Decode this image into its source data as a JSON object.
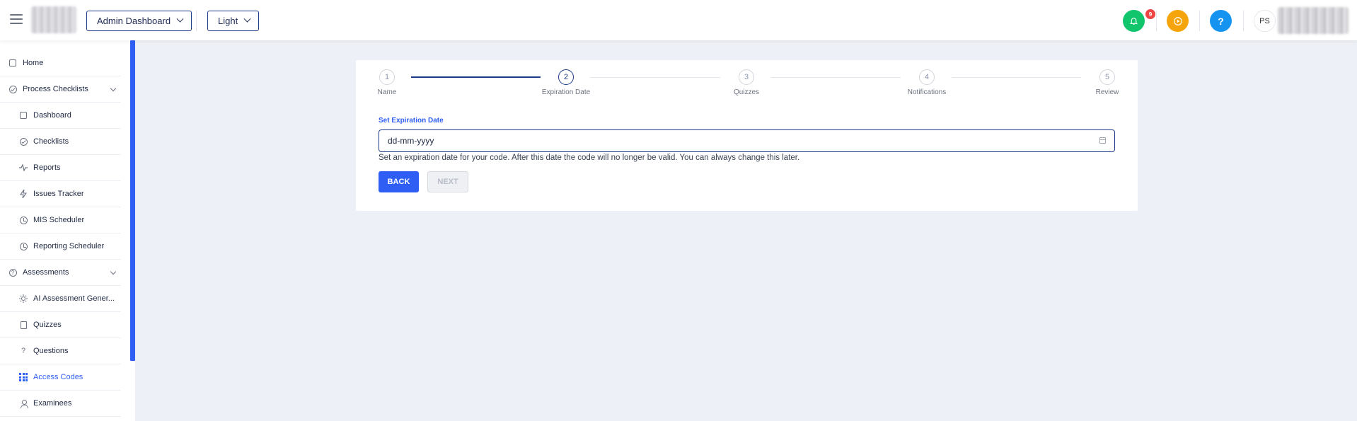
{
  "header": {
    "dashboard_select": "Admin Dashboard",
    "theme_select": "Light",
    "notification_count": "9",
    "help_label": "?",
    "avatar_initials": "PS"
  },
  "sidebar": {
    "items": [
      {
        "label": "Home",
        "icon": "home-icon"
      },
      {
        "label": "Process Checklists",
        "icon": "check-circle-icon",
        "expanded": true
      },
      {
        "label": "Dashboard",
        "icon": "home-icon"
      },
      {
        "label": "Checklists",
        "icon": "check-circle-icon"
      },
      {
        "label": "Reports",
        "icon": "activity-icon"
      },
      {
        "label": "Issues Tracker",
        "icon": "lightning-icon"
      },
      {
        "label": "MIS Scheduler",
        "icon": "clock-icon"
      },
      {
        "label": "Reporting Scheduler",
        "icon": "clock-icon"
      },
      {
        "label": "Assessments",
        "icon": "question-circle-icon",
        "expanded": true
      },
      {
        "label": "AI Assessment Gener...",
        "icon": "bulb-icon"
      },
      {
        "label": "Quizzes",
        "icon": "document-icon"
      },
      {
        "label": "Questions",
        "icon": "question-icon"
      },
      {
        "label": "Access Codes",
        "icon": "grid-icon",
        "active": true
      },
      {
        "label": "Examinees",
        "icon": "person-icon"
      }
    ]
  },
  "stepper": {
    "steps": [
      {
        "num": "1",
        "label": "Name"
      },
      {
        "num": "2",
        "label": "Expiration Date",
        "active": true
      },
      {
        "num": "3",
        "label": "Quizzes"
      },
      {
        "num": "4",
        "label": "Notifications"
      },
      {
        "num": "5",
        "label": "Review"
      }
    ]
  },
  "form": {
    "label": "Set Expiration Date",
    "date_value": "dd-mm-yyyy",
    "help_text": "Set an expiration date for your code. After this date the code will no longer be valid. You can always change this later.",
    "back_label": "BACK",
    "next_label": "NEXT"
  },
  "colors": {
    "accent": "#2f5ef5",
    "notification_green": "#10c56b",
    "play_orange": "#f5a50b",
    "help_blue": "#1494f0"
  }
}
